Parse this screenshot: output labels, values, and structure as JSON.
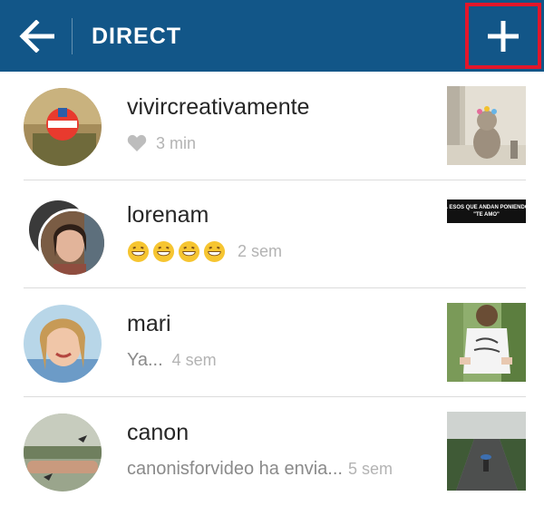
{
  "header": {
    "title": "DIRECT",
    "back_icon": "arrow-left-icon",
    "new_icon": "plus-icon",
    "bg_color": "#125688",
    "highlight_color": "#e2162a"
  },
  "threads": [
    {
      "username": "vivircreativamente",
      "status_icon": "heart-icon",
      "message": "",
      "time": "3 min"
    },
    {
      "username": "lorenam",
      "status_icon": "grinning-emoji-icon",
      "emoji_count": 4,
      "message": "",
      "time": "2 sem"
    },
    {
      "username": "mari",
      "message": "Ya...",
      "time": "4 sem"
    },
    {
      "username": "canon",
      "message": "canonisforvideo ha envia...",
      "time": "5 sem"
    }
  ],
  "thumb_texts": {
    "lorenam_line1": "A ESOS QUE ANDAN PONIENDO",
    "lorenam_line2": "\"TE AMO\""
  }
}
